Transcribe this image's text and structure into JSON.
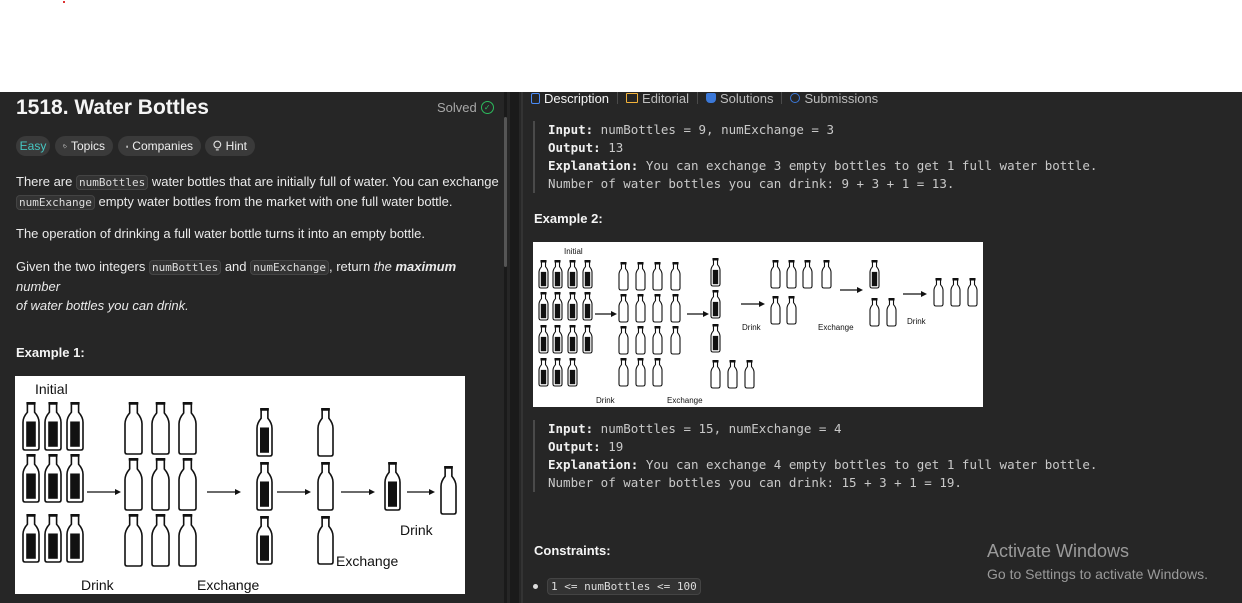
{
  "problem": {
    "title": "1518. Water Bottles",
    "status": "Solved",
    "tags": {
      "difficulty": "Easy",
      "topics": "Topics",
      "companies": "Companies",
      "hint": "Hint"
    },
    "desc1": {
      "p1": "There are ",
      "code1": "numBottles",
      "p2": " water bottles that are initially full of water. You can exchange",
      "code2": "numExchange",
      "p3": " empty water bottles from the market with one full water bottle."
    },
    "desc2": "The operation of drinking a full water bottle turns it into an empty bottle.",
    "desc3": {
      "p1": "Given the two integers ",
      "code1": "numBottles",
      "p2": " and ",
      "code2": "numExchange",
      "p3": ", return ",
      "em1": "the ",
      "strong": "maximum",
      "em2": " number",
      "em3": "of water bottles you can drink."
    },
    "example1": {
      "heading": "Example 1:",
      "img_labels": {
        "initial": "Initial",
        "drink": "Drink",
        "exchange": "Exchange",
        "drink2": "Drink",
        "exchange2": "Exchange"
      }
    }
  },
  "tabs": [
    {
      "label": "Description",
      "icon": "description-icon",
      "active": true
    },
    {
      "label": "Editorial",
      "icon": "book-icon"
    },
    {
      "label": "Solutions",
      "icon": "flask-icon"
    },
    {
      "label": "Submissions",
      "icon": "history-icon"
    }
  ],
  "example1_io": {
    "input_label": "Input:",
    "input": " numBottles = 9, numExchange = 3",
    "output_label": "Output:",
    "output": " 13",
    "expl_label": "Explanation:",
    "expl": " You can exchange 3 empty bottles to get 1 full water bottle.",
    "expl2": "Number of water bottles you can drink: 9 + 3 + 1 = 13."
  },
  "example2": {
    "heading": "Example 2:",
    "img_labels": {
      "initial": "Initial",
      "drink": "Drink",
      "exchange": "Exchange",
      "drink2": "Drink",
      "exchange2": "Exchange",
      "drink3": "Drink"
    },
    "input_label": "Input:",
    "input": " numBottles = 15, numExchange = 4",
    "output_label": "Output:",
    "output": " 19",
    "expl_label": "Explanation:",
    "expl": " You can exchange 4 empty bottles to get 1 full water bottle.",
    "expl2": "Number of water bottles you can drink: 15 + 3 + 1 = 19."
  },
  "constraints": {
    "heading": "Constraints:",
    "item1": "1 <= numBottles <= 100"
  },
  "watermark": {
    "line1": "Activate Windows",
    "line2": "Go to Settings to activate Windows."
  },
  "colors": {
    "accent_easy": "#46c6c2",
    "solved": "#2cbb5d",
    "bg_panel": "#262626"
  }
}
